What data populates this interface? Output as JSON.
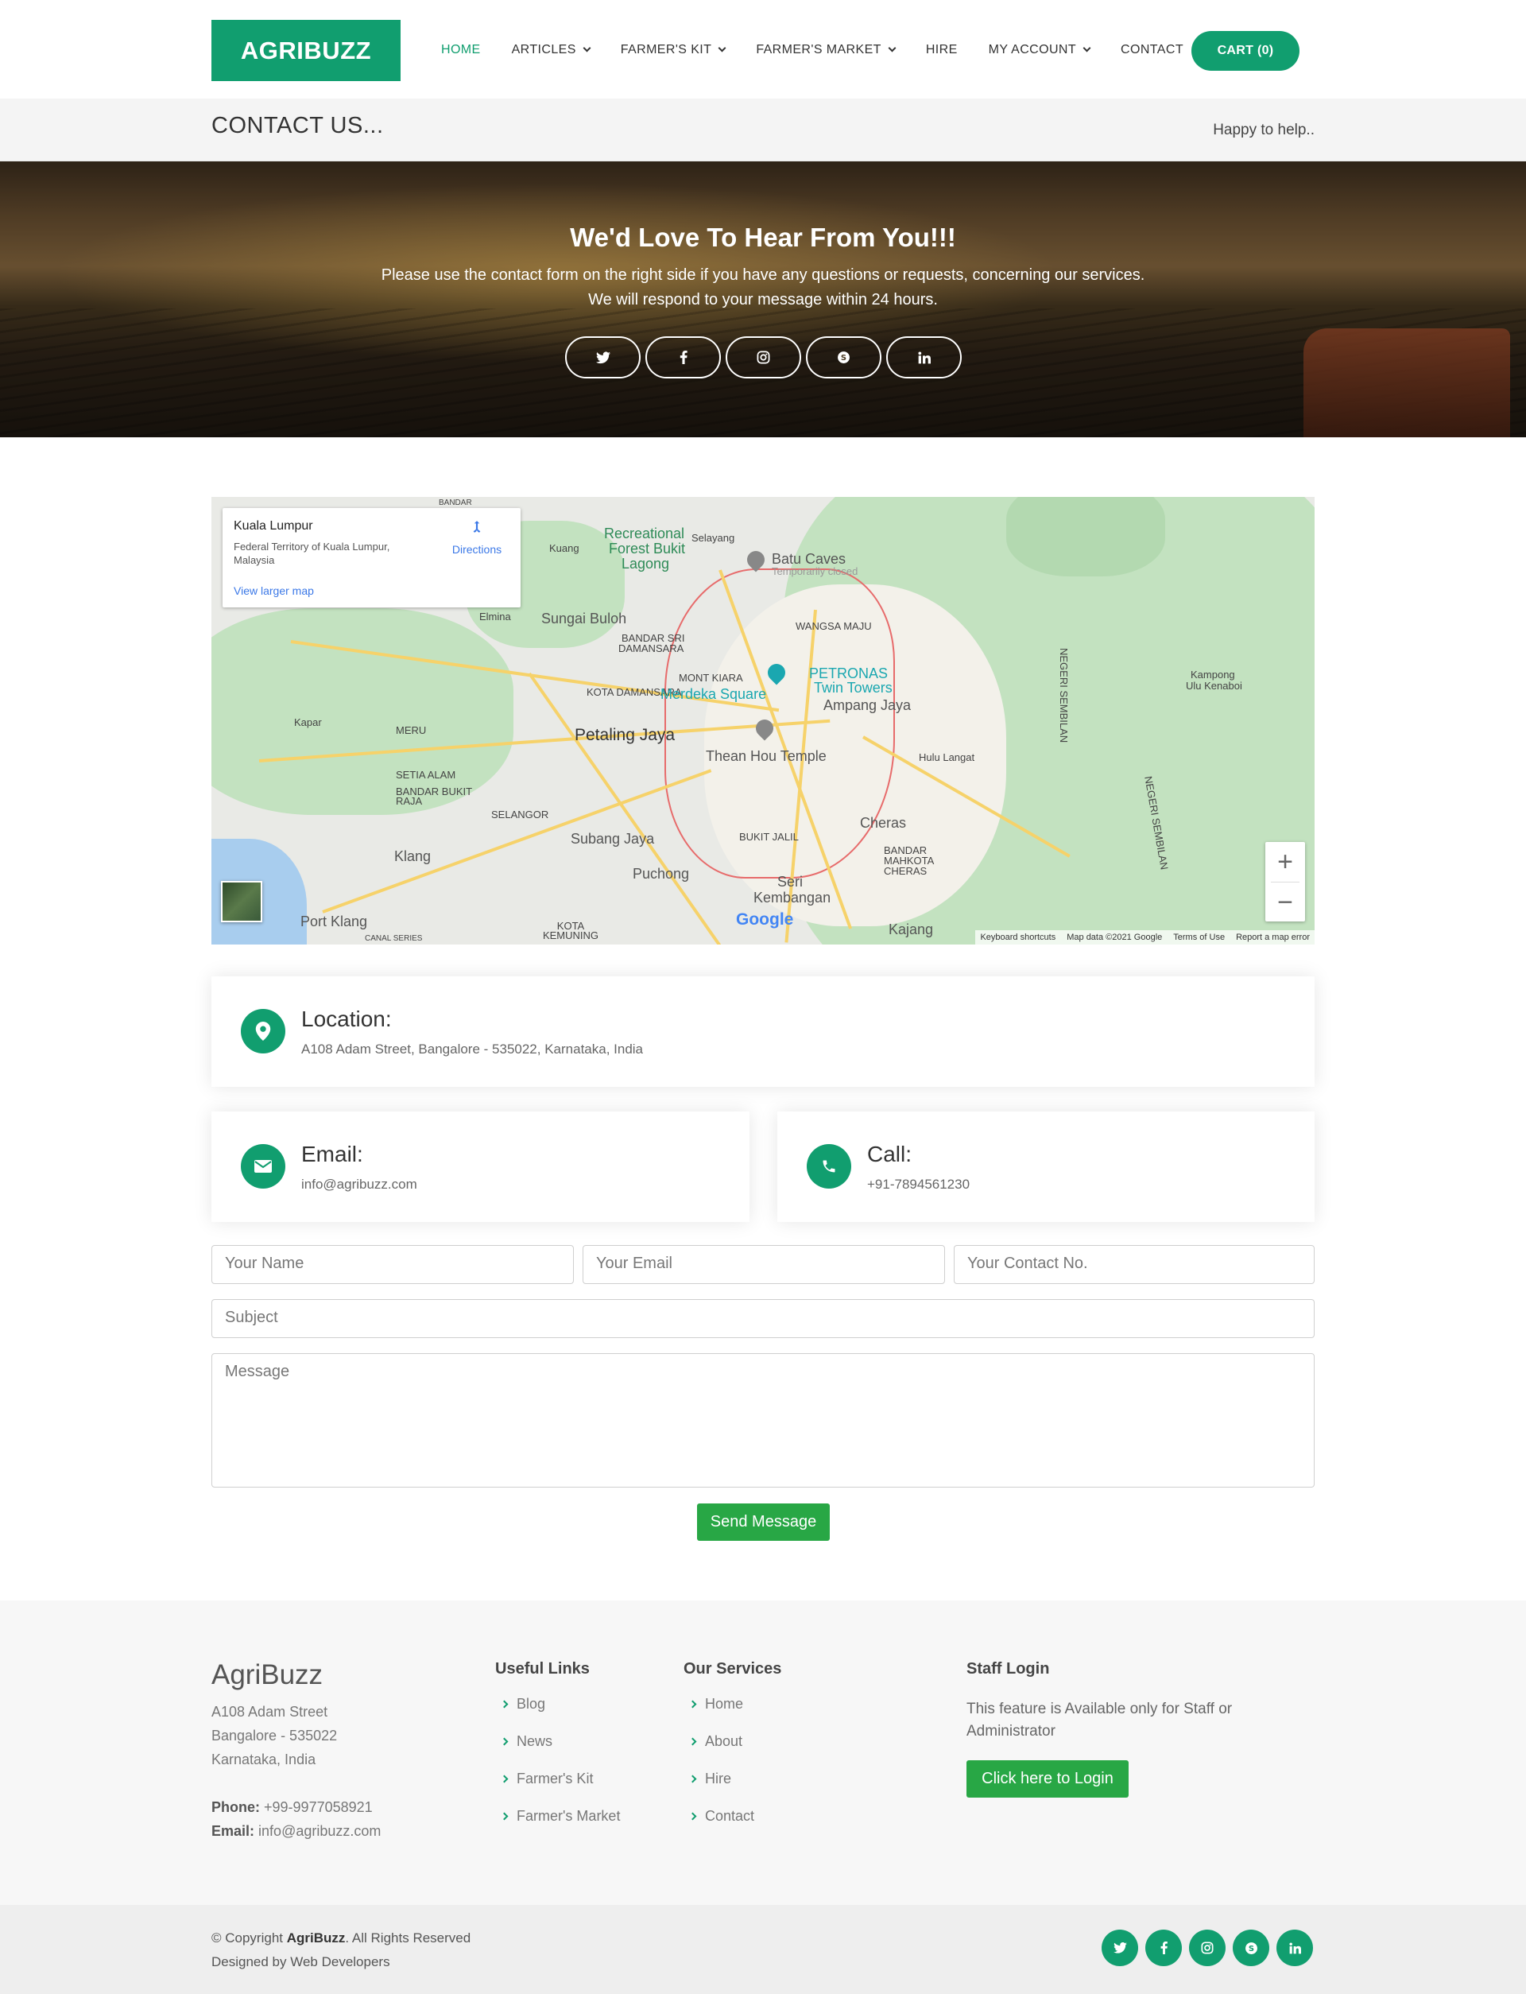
{
  "brand": {
    "logo_text": "AGRIBUZZ",
    "accent_color": "#119e6f",
    "button_color": "#28a745"
  },
  "nav": {
    "items": [
      {
        "label": "HOME",
        "active": true,
        "dropdown": false
      },
      {
        "label": "ARTICLES",
        "active": false,
        "dropdown": true
      },
      {
        "label": "FARMER'S KIT",
        "active": false,
        "dropdown": true
      },
      {
        "label": "FARMER'S MARKET",
        "active": false,
        "dropdown": true
      },
      {
        "label": "HIRE",
        "active": false,
        "dropdown": false
      },
      {
        "label": "MY ACCOUNT",
        "active": false,
        "dropdown": true
      },
      {
        "label": "CONTACT",
        "active": false,
        "dropdown": false
      }
    ],
    "cart_label": "CART (0)"
  },
  "breadcrumb": {
    "title": "CONTACT US...",
    "tagline": "Happy to help.."
  },
  "hero": {
    "title": "We'd Love To Hear From You!!!",
    "line1": "Please use the contact form on the right side if you have any questions or requests, concerning our services.",
    "line2": "We will respond to your message within 24 hours.",
    "social": [
      {
        "icon": "twitter-icon",
        "glyph": "t"
      },
      {
        "icon": "facebook-icon",
        "glyph": "f"
      },
      {
        "icon": "instagram-icon",
        "glyph": "◎"
      },
      {
        "icon": "skype-icon",
        "glyph": "S"
      },
      {
        "icon": "linkedin-icon",
        "glyph": "in"
      }
    ]
  },
  "map": {
    "place_title": "Kuala Lumpur",
    "place_sub": "Federal Territory of Kuala Lumpur, Malaysia",
    "larger_map": "View larger map",
    "directions": "Directions",
    "labels": {
      "recreational": "Recreational",
      "forest": "Forest Bukit",
      "lagong": "Lagong",
      "selayang": "Selayang",
      "batu_caves": "Batu Caves",
      "temp_closed": "Temporarily closed",
      "kuang": "Kuang",
      "elmina": "Elmina",
      "sungai_buloh": "Sungai Buloh",
      "bandar_sri": "BANDAR SRI",
      "damansara": "DAMANSARA",
      "wangsa_maju": "WANGSA MAJU",
      "mont_kiara": "MONT KIARA",
      "kota_damansara": "KOTA DAMANSARA",
      "merdeka": "Merdeka Square",
      "petronas": "PETRONAS",
      "twin_towers": "Twin Towers",
      "ampang_jaya": "Ampang Jaya",
      "kapar": "Kapar",
      "meru": "MERU",
      "petaling_jaya": "Petaling Jaya",
      "setia_alam": "SETIA ALAM",
      "thean_hou": "Thean Hou Temple",
      "hulu_langat": "Hulu Langat",
      "bandar_bukit_raja": "BANDAR BUKIT RAJA",
      "selangor": "SELANGOR",
      "cheras": "Cheras",
      "subang_jaya": "Subang Jaya",
      "bukit_jalil": "BUKIT JALIL",
      "klang": "Klang",
      "bandar_mahkota": "BANDAR MAHKOTA CHERAS",
      "puchong": "Puchong",
      "seri": "Seri",
      "kembangan": "Kembangan",
      "port_klang": "Port Klang",
      "kota_kemuning": "KOTA KEMUNING",
      "kajang": "Kajang",
      "canal_series": "CANAL SERIES",
      "kampong": "Kampong",
      "ulu_kenaboi": "Ulu Kenaboi",
      "negeri_sembilan": "NEGERI SEMBILAN",
      "bandar": "BANDAR"
    },
    "attrib": [
      "Keyboard shortcuts",
      "Map data ©2021 Google",
      "Terms of Use",
      "Report a map error"
    ],
    "google": "Google",
    "zoom_in": "+",
    "zoom_out": "−"
  },
  "info": {
    "location": {
      "title": "Location:",
      "text": "A108 Adam Street, Bangalore - 535022, Karnataka, India"
    },
    "email": {
      "title": "Email:",
      "text": "info@agribuzz.com"
    },
    "call": {
      "title": "Call:",
      "text": "+91-7894561230"
    }
  },
  "form": {
    "name_placeholder": "Your Name",
    "email_placeholder": "Your Email",
    "contact_placeholder": "Your Contact  No.",
    "subject_placeholder": "Subject",
    "message_placeholder": "Message",
    "send_label": "Send Message"
  },
  "footer": {
    "brand": "AgriBuzz",
    "address": [
      "A108 Adam Street",
      "Bangalore - 535022",
      "Karnataka, India"
    ],
    "phone_label": "Phone:",
    "phone": "+99-9977058921",
    "email_label": "Email:",
    "email": "info@agribuzz.com",
    "useful_links_title": "Useful Links",
    "useful_links": [
      "Blog",
      "News",
      "Farmer's Kit",
      "Farmer's Market"
    ],
    "services_title": "Our Services",
    "services": [
      "Home",
      "About",
      "Hire",
      "Contact"
    ],
    "staff_title": "Staff Login",
    "staff_text": "This feature is Available only for Staff or Administrator",
    "login_label": "Click here to Login",
    "copyright_prefix": "© Copyright ",
    "copyright_brand": "AgriBuzz",
    "copyright_suffix": ". All Rights Reserved",
    "designed": "Designed by Web Developers"
  }
}
